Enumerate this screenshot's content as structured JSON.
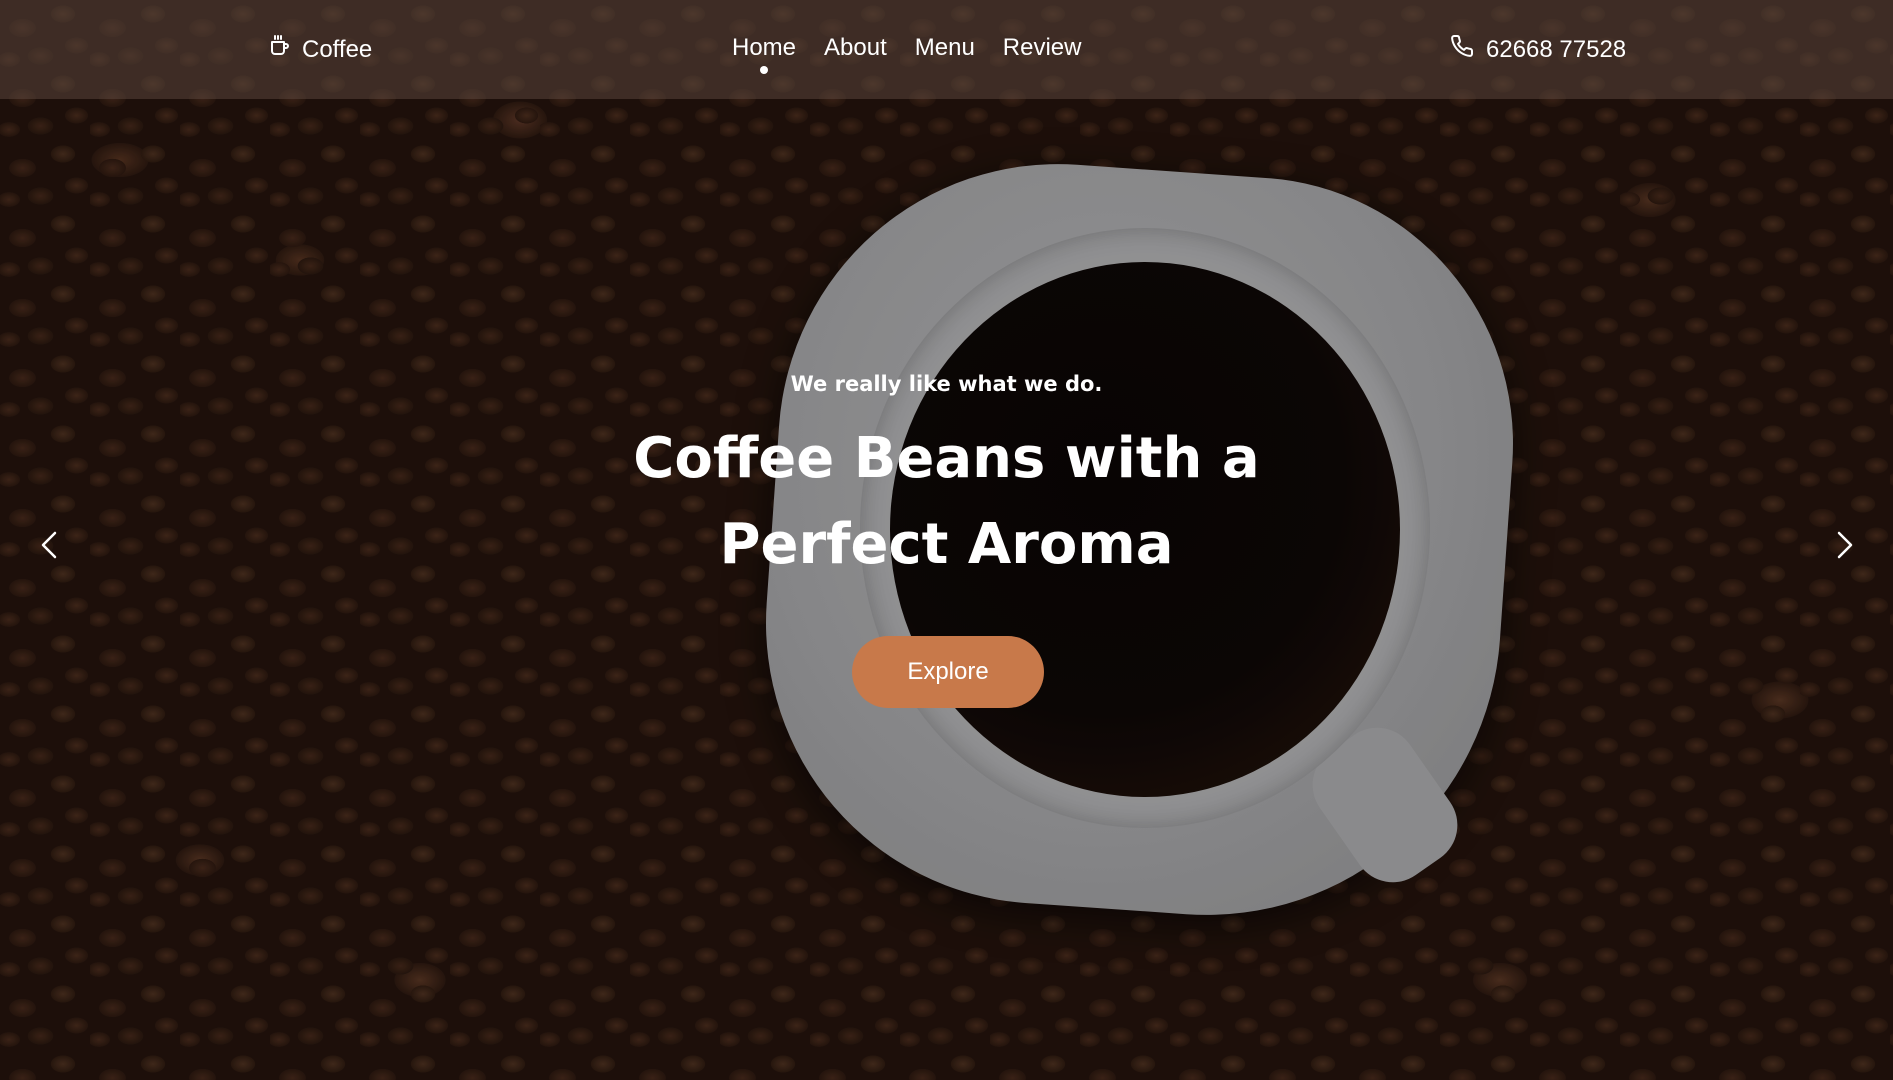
{
  "navbar": {
    "brand": "Coffee",
    "brand_icon": "coffee-cup-icon",
    "links": [
      {
        "label": "Home",
        "active": true
      },
      {
        "label": "About",
        "active": false
      },
      {
        "label": "Menu",
        "active": false
      },
      {
        "label": "Review",
        "active": false
      }
    ],
    "phone": "62668 77528",
    "phone_icon": "phone-icon"
  },
  "hero": {
    "kicker": "We really like what we do.",
    "title_line1": "Coffee Beans with a",
    "title_line2": "Perfect Aroma",
    "cta_label": "Explore",
    "prev_icon": "chevron-left-icon",
    "next_icon": "chevron-right-icon"
  },
  "colors": {
    "accent": "#c8794a",
    "text": "#ffffff"
  }
}
